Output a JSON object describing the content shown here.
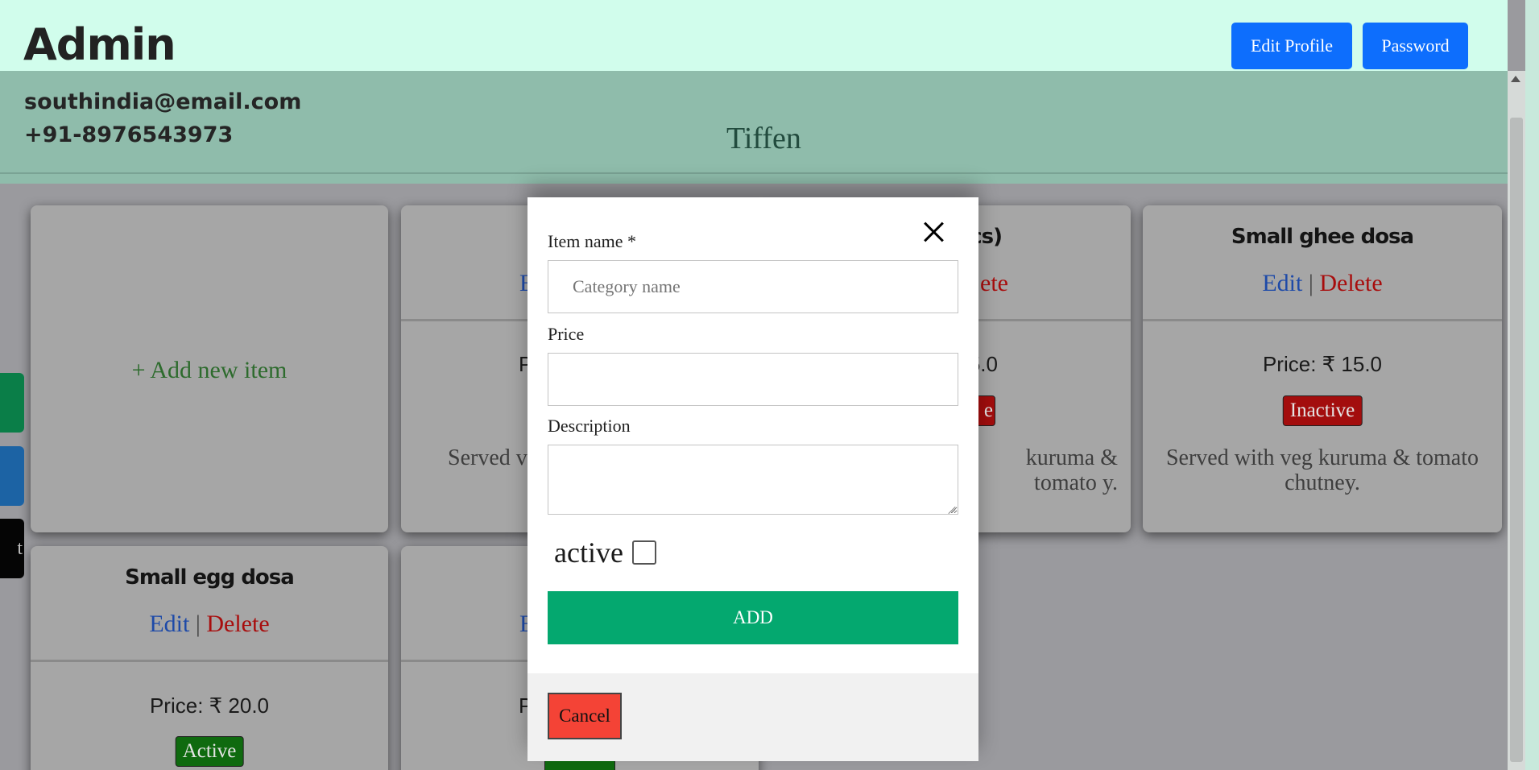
{
  "header": {
    "title": "Admin",
    "edit_profile_label": "Edit Profile",
    "password_label": "Password"
  },
  "info": {
    "email": "southindia@email.com",
    "phone": "+91-8976543973",
    "category": "Tiffen"
  },
  "add_new_label": "+ Add new item",
  "actions": {
    "edit": "Edit",
    "separator": "|",
    "delete": "Delete"
  },
  "cards": [
    {
      "name": "",
      "edit": "E",
      "delete": "",
      "price": "P",
      "status": "",
      "description": "Served v"
    },
    {
      "name": "2 pcs)",
      "edit": "",
      "delete": "ete",
      "price": "25.0",
      "status": "e",
      "description": "kuruma & tomato y."
    },
    {
      "name": "Small ghee dosa",
      "price": "Price: ₹ 15.0",
      "status": "Inactive",
      "description": "Served with veg kuruma & tomato chutney."
    },
    {
      "name": "Small egg dosa",
      "price": "Price: ₹ 20.0",
      "status": "Active"
    },
    {
      "name": "",
      "edit": "E",
      "price": "P"
    }
  ],
  "side_tabs": {
    "third_text": "t"
  },
  "modal": {
    "item_name_label": "Item name *",
    "item_name_placeholder": "Category name",
    "item_name_value": "",
    "price_label": "Price",
    "price_value": "",
    "description_label": "Description",
    "description_value": "",
    "active_label": "active",
    "active_checked": false,
    "add_label": "ADD",
    "cancel_label": "Cancel"
  },
  "colors": {
    "header_bg": "#d1fdec",
    "info_bg": "#8fbcab",
    "primary_button": "#0d6efd",
    "add_button": "#04a86f",
    "cancel_button": "#f44336",
    "inactive": "#a30d0d",
    "active": "#0f6a0f"
  },
  "icons": {
    "close": "close-icon"
  }
}
